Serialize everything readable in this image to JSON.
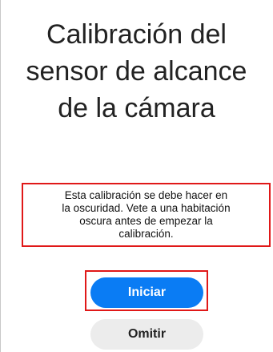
{
  "title_lines": [
    "Calibración del",
    "sensor de alcance",
    "de la cámara"
  ],
  "message_lines": [
    "Esta calibración se debe hacer en",
    "la oscuridad. Vete a una habitación",
    "oscura antes de empezar la",
    "calibración."
  ],
  "buttons": {
    "start_label": "Iniciar",
    "skip_label": "Omitir"
  },
  "colors": {
    "accent": "#0a7cf4",
    "highlight": "#e01818",
    "secondary_button": "#ececec"
  }
}
